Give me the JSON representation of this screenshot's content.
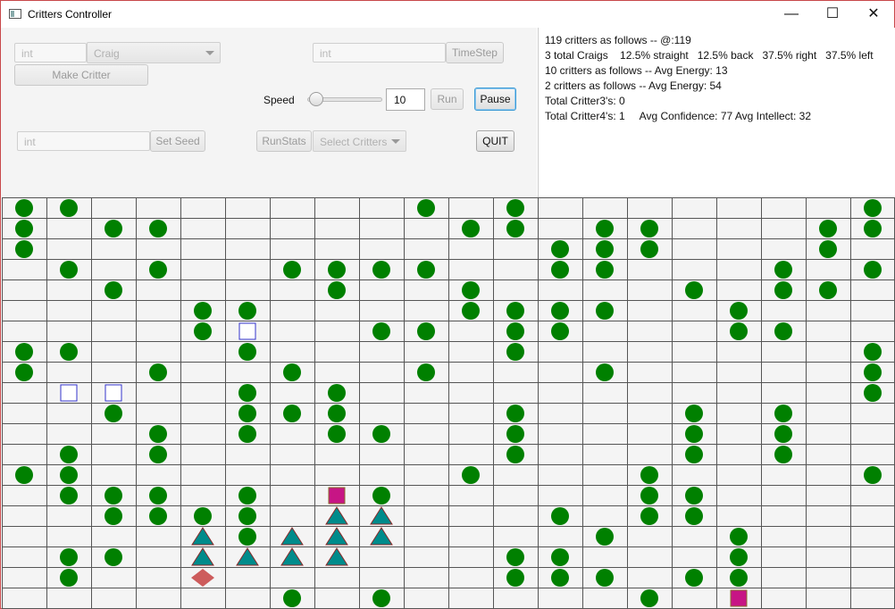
{
  "window": {
    "title": "Critters Controller",
    "minimize_glyph": "—",
    "maximize_glyph": "☐",
    "close_glyph": "✕"
  },
  "controls": {
    "make_count_placeholder": "int",
    "critter_type_selected": "Craig",
    "make_button": "Make Critter",
    "timestep_placeholder": "int",
    "timestep_button": "TimeStep",
    "speed_label": "Speed",
    "speed_value": "10",
    "speed_slider_level": 0.05,
    "run_button": "Run",
    "pause_button": "Pause",
    "seed_placeholder": "int",
    "seed_button": "Set Seed",
    "runstats_button": "RunStats",
    "select_critters_label": "Select Critters",
    "quit_button": "QUIT"
  },
  "stats": {
    "line1": "119 critters as follows -- @:119",
    "line2": "3 total Craigs    12.5% straight   12.5% back   37.5% right   37.5% left",
    "line3": "10 critters as follows -- Avg Energy: 13",
    "line4": "2 critters as follows -- Avg Energy: 54",
    "line5": "Total Critter3's: 0",
    "line6": "Total Critter4's: 1     Avg Confidence: 77 Avg Intellect: 32"
  },
  "colors": {
    "algae": "#008000",
    "square_outline": "#3333cc",
    "magenta": "#c71585",
    "teal": "#008b8b",
    "diamond": "#cd5c5c",
    "grid_line": "#555555"
  },
  "world": {
    "columns": 20,
    "rows": 20,
    "cells": [
      {
        "col": 0,
        "row": 0,
        "shape": "circle"
      },
      {
        "col": 1,
        "row": 0,
        "shape": "circle"
      },
      {
        "col": 9,
        "row": 0,
        "shape": "circle"
      },
      {
        "col": 11,
        "row": 0,
        "shape": "circle"
      },
      {
        "col": 19,
        "row": 0,
        "shape": "circle"
      },
      {
        "col": 0,
        "row": 1,
        "shape": "circle"
      },
      {
        "col": 2,
        "row": 1,
        "shape": "circle"
      },
      {
        "col": 3,
        "row": 1,
        "shape": "circle"
      },
      {
        "col": 10,
        "row": 1,
        "shape": "circle"
      },
      {
        "col": 11,
        "row": 1,
        "shape": "circle"
      },
      {
        "col": 13,
        "row": 1,
        "shape": "circle"
      },
      {
        "col": 14,
        "row": 1,
        "shape": "circle"
      },
      {
        "col": 18,
        "row": 1,
        "shape": "circle"
      },
      {
        "col": 19,
        "row": 1,
        "shape": "circle"
      },
      {
        "col": 0,
        "row": 2,
        "shape": "circle"
      },
      {
        "col": 12,
        "row": 2,
        "shape": "circle"
      },
      {
        "col": 13,
        "row": 2,
        "shape": "circle"
      },
      {
        "col": 14,
        "row": 2,
        "shape": "circle"
      },
      {
        "col": 18,
        "row": 2,
        "shape": "circle"
      },
      {
        "col": 1,
        "row": 3,
        "shape": "circle"
      },
      {
        "col": 3,
        "row": 3,
        "shape": "circle"
      },
      {
        "col": 6,
        "row": 3,
        "shape": "circle"
      },
      {
        "col": 7,
        "row": 3,
        "shape": "circle"
      },
      {
        "col": 8,
        "row": 3,
        "shape": "circle"
      },
      {
        "col": 9,
        "row": 3,
        "shape": "circle"
      },
      {
        "col": 12,
        "row": 3,
        "shape": "circle"
      },
      {
        "col": 13,
        "row": 3,
        "shape": "circle"
      },
      {
        "col": 17,
        "row": 3,
        "shape": "circle"
      },
      {
        "col": 19,
        "row": 3,
        "shape": "circle"
      },
      {
        "col": 2,
        "row": 4,
        "shape": "circle"
      },
      {
        "col": 7,
        "row": 4,
        "shape": "circle"
      },
      {
        "col": 10,
        "row": 4,
        "shape": "circle"
      },
      {
        "col": 15,
        "row": 4,
        "shape": "circle"
      },
      {
        "col": 17,
        "row": 4,
        "shape": "circle"
      },
      {
        "col": 18,
        "row": 4,
        "shape": "circle"
      },
      {
        "col": 4,
        "row": 5,
        "shape": "circle"
      },
      {
        "col": 5,
        "row": 5,
        "shape": "circle"
      },
      {
        "col": 10,
        "row": 5,
        "shape": "circle"
      },
      {
        "col": 11,
        "row": 5,
        "shape": "circle"
      },
      {
        "col": 12,
        "row": 5,
        "shape": "circle"
      },
      {
        "col": 13,
        "row": 5,
        "shape": "circle"
      },
      {
        "col": 16,
        "row": 5,
        "shape": "circle"
      },
      {
        "col": 4,
        "row": 6,
        "shape": "circle"
      },
      {
        "col": 5,
        "row": 6,
        "shape": "square-outline"
      },
      {
        "col": 8,
        "row": 6,
        "shape": "circle"
      },
      {
        "col": 9,
        "row": 6,
        "shape": "circle"
      },
      {
        "col": 11,
        "row": 6,
        "shape": "circle"
      },
      {
        "col": 12,
        "row": 6,
        "shape": "circle"
      },
      {
        "col": 16,
        "row": 6,
        "shape": "circle"
      },
      {
        "col": 17,
        "row": 6,
        "shape": "circle"
      },
      {
        "col": 0,
        "row": 7,
        "shape": "circle"
      },
      {
        "col": 1,
        "row": 7,
        "shape": "circle"
      },
      {
        "col": 5,
        "row": 7,
        "shape": "circle"
      },
      {
        "col": 11,
        "row": 7,
        "shape": "circle"
      },
      {
        "col": 19,
        "row": 7,
        "shape": "circle"
      },
      {
        "col": 0,
        "row": 8,
        "shape": "circle"
      },
      {
        "col": 3,
        "row": 8,
        "shape": "circle"
      },
      {
        "col": 6,
        "row": 8,
        "shape": "circle"
      },
      {
        "col": 9,
        "row": 8,
        "shape": "circle"
      },
      {
        "col": 13,
        "row": 8,
        "shape": "circle"
      },
      {
        "col": 19,
        "row": 8,
        "shape": "circle"
      },
      {
        "col": 1,
        "row": 9,
        "shape": "square-outline"
      },
      {
        "col": 2,
        "row": 9,
        "shape": "square-outline"
      },
      {
        "col": 5,
        "row": 9,
        "shape": "circle"
      },
      {
        "col": 7,
        "row": 9,
        "shape": "circle"
      },
      {
        "col": 19,
        "row": 9,
        "shape": "circle"
      },
      {
        "col": 2,
        "row": 10,
        "shape": "circle"
      },
      {
        "col": 5,
        "row": 10,
        "shape": "circle"
      },
      {
        "col": 6,
        "row": 10,
        "shape": "circle"
      },
      {
        "col": 7,
        "row": 10,
        "shape": "circle"
      },
      {
        "col": 11,
        "row": 10,
        "shape": "circle"
      },
      {
        "col": 15,
        "row": 10,
        "shape": "circle"
      },
      {
        "col": 17,
        "row": 10,
        "shape": "circle"
      },
      {
        "col": 3,
        "row": 11,
        "shape": "circle"
      },
      {
        "col": 5,
        "row": 11,
        "shape": "circle"
      },
      {
        "col": 7,
        "row": 11,
        "shape": "circle"
      },
      {
        "col": 8,
        "row": 11,
        "shape": "circle"
      },
      {
        "col": 11,
        "row": 11,
        "shape": "circle"
      },
      {
        "col": 15,
        "row": 11,
        "shape": "circle"
      },
      {
        "col": 17,
        "row": 11,
        "shape": "circle"
      },
      {
        "col": 1,
        "row": 12,
        "shape": "circle"
      },
      {
        "col": 3,
        "row": 12,
        "shape": "circle"
      },
      {
        "col": 11,
        "row": 12,
        "shape": "circle"
      },
      {
        "col": 15,
        "row": 12,
        "shape": "circle"
      },
      {
        "col": 17,
        "row": 12,
        "shape": "circle"
      },
      {
        "col": 0,
        "row": 13,
        "shape": "circle"
      },
      {
        "col": 1,
        "row": 13,
        "shape": "circle"
      },
      {
        "col": 10,
        "row": 13,
        "shape": "circle"
      },
      {
        "col": 14,
        "row": 13,
        "shape": "circle"
      },
      {
        "col": 19,
        "row": 13,
        "shape": "circle"
      },
      {
        "col": 1,
        "row": 14,
        "shape": "circle"
      },
      {
        "col": 2,
        "row": 14,
        "shape": "circle"
      },
      {
        "col": 3,
        "row": 14,
        "shape": "circle"
      },
      {
        "col": 5,
        "row": 14,
        "shape": "circle"
      },
      {
        "col": 7,
        "row": 14,
        "shape": "square-filled"
      },
      {
        "col": 8,
        "row": 14,
        "shape": "circle"
      },
      {
        "col": 14,
        "row": 14,
        "shape": "circle"
      },
      {
        "col": 15,
        "row": 14,
        "shape": "circle"
      },
      {
        "col": 2,
        "row": 15,
        "shape": "circle"
      },
      {
        "col": 3,
        "row": 15,
        "shape": "circle"
      },
      {
        "col": 4,
        "row": 15,
        "shape": "circle"
      },
      {
        "col": 5,
        "row": 15,
        "shape": "circle"
      },
      {
        "col": 7,
        "row": 15,
        "shape": "triangle"
      },
      {
        "col": 8,
        "row": 15,
        "shape": "triangle"
      },
      {
        "col": 12,
        "row": 15,
        "shape": "circle"
      },
      {
        "col": 14,
        "row": 15,
        "shape": "circle"
      },
      {
        "col": 15,
        "row": 15,
        "shape": "circle"
      },
      {
        "col": 4,
        "row": 16,
        "shape": "triangle"
      },
      {
        "col": 5,
        "row": 16,
        "shape": "circle"
      },
      {
        "col": 6,
        "row": 16,
        "shape": "triangle"
      },
      {
        "col": 7,
        "row": 16,
        "shape": "triangle"
      },
      {
        "col": 8,
        "row": 16,
        "shape": "triangle"
      },
      {
        "col": 13,
        "row": 16,
        "shape": "circle"
      },
      {
        "col": 16,
        "row": 16,
        "shape": "circle"
      },
      {
        "col": 1,
        "row": 17,
        "shape": "circle"
      },
      {
        "col": 2,
        "row": 17,
        "shape": "circle"
      },
      {
        "col": 4,
        "row": 17,
        "shape": "triangle"
      },
      {
        "col": 5,
        "row": 17,
        "shape": "triangle"
      },
      {
        "col": 6,
        "row": 17,
        "shape": "triangle"
      },
      {
        "col": 7,
        "row": 17,
        "shape": "triangle"
      },
      {
        "col": 11,
        "row": 17,
        "shape": "circle"
      },
      {
        "col": 12,
        "row": 17,
        "shape": "circle"
      },
      {
        "col": 16,
        "row": 17,
        "shape": "circle"
      },
      {
        "col": 1,
        "row": 18,
        "shape": "circle"
      },
      {
        "col": 4,
        "row": 18,
        "shape": "diamond"
      },
      {
        "col": 11,
        "row": 18,
        "shape": "circle"
      },
      {
        "col": 12,
        "row": 18,
        "shape": "circle"
      },
      {
        "col": 13,
        "row": 18,
        "shape": "circle"
      },
      {
        "col": 15,
        "row": 18,
        "shape": "circle"
      },
      {
        "col": 16,
        "row": 18,
        "shape": "circle"
      },
      {
        "col": 6,
        "row": 19,
        "shape": "circle"
      },
      {
        "col": 8,
        "row": 19,
        "shape": "circle"
      },
      {
        "col": 14,
        "row": 19,
        "shape": "circle"
      },
      {
        "col": 16,
        "row": 19,
        "shape": "square-filled"
      }
    ]
  }
}
